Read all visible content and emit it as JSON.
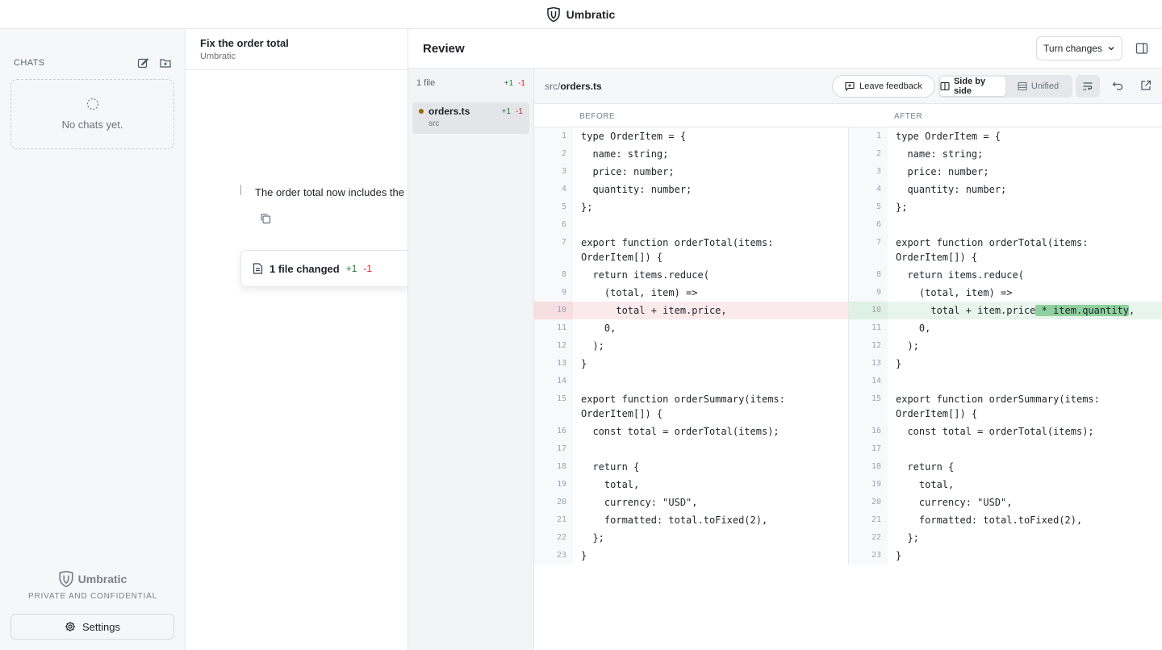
{
  "app": {
    "title": "Umbratic"
  },
  "sidebar": {
    "chats_label": "CHATS",
    "empty_text": "No chats yet.",
    "brand": "Umbratic",
    "tagline": "PRIVATE AND CONFIDENTIAL",
    "settings_label": "Settings"
  },
  "chat": {
    "title": "Fix the order total",
    "subtitle": "Umbratic",
    "message": "The order total now includes the",
    "files_changed": "1 file changed",
    "additions": "+1",
    "deletions": "-1"
  },
  "review": {
    "title": "Review",
    "turn_changes": "Turn changes",
    "file_count": "1 file",
    "additions": "+1",
    "deletions": "-1",
    "file": {
      "name": "orders.ts",
      "dir": "src",
      "additions": "+1",
      "deletions": "-1"
    },
    "path_dir": "src/",
    "path_file": "orders.ts",
    "leave_feedback": "Leave feedback",
    "view_side_by_side": "Side by side",
    "view_unified": "Unified",
    "before_label": "BEFORE",
    "after_label": "AFTER"
  },
  "diff": {
    "before": [
      {
        "n": "1",
        "code": "type OrderItem = {"
      },
      {
        "n": "2",
        "code": "  name: string;"
      },
      {
        "n": "3",
        "code": "  price: number;"
      },
      {
        "n": "4",
        "code": "  quantity: number;"
      },
      {
        "n": "5",
        "code": "};"
      },
      {
        "n": "6",
        "code": ""
      },
      {
        "n": "7",
        "code": "export function orderTotal(items: OrderItem[]) {"
      },
      {
        "n": "8",
        "code": "  return items.reduce("
      },
      {
        "n": "9",
        "code": "    (total, item) =>"
      },
      {
        "n": "10",
        "code": "      total + item.price,",
        "type": "del"
      },
      {
        "n": "11",
        "code": "    0,"
      },
      {
        "n": "12",
        "code": "  );"
      },
      {
        "n": "13",
        "code": "}"
      },
      {
        "n": "14",
        "code": ""
      },
      {
        "n": "15",
        "code": "export function orderSummary(items: OrderItem[]) {"
      },
      {
        "n": "16",
        "code": "  const total = orderTotal(items);"
      },
      {
        "n": "17",
        "code": ""
      },
      {
        "n": "18",
        "code": "  return {"
      },
      {
        "n": "19",
        "code": "    total,"
      },
      {
        "n": "20",
        "code": "    currency: \"USD\","
      },
      {
        "n": "21",
        "code": "    formatted: total.toFixed(2),"
      },
      {
        "n": "22",
        "code": "  };"
      },
      {
        "n": "23",
        "code": "}"
      }
    ],
    "after": [
      {
        "n": "1",
        "code": "type OrderItem = {"
      },
      {
        "n": "2",
        "code": "  name: string;"
      },
      {
        "n": "3",
        "code": "  price: number;"
      },
      {
        "n": "4",
        "code": "  quantity: number;"
      },
      {
        "n": "5",
        "code": "};"
      },
      {
        "n": "6",
        "code": ""
      },
      {
        "n": "7",
        "code": "export function orderTotal(items: OrderItem[]) {"
      },
      {
        "n": "8",
        "code": "  return items.reduce("
      },
      {
        "n": "9",
        "code": "    (total, item) =>"
      },
      {
        "n": "10",
        "code": "      total + item.price",
        "hl": " * item.quantity",
        "tail": ",",
        "type": "add"
      },
      {
        "n": "11",
        "code": "    0,"
      },
      {
        "n": "12",
        "code": "  );"
      },
      {
        "n": "13",
        "code": "}"
      },
      {
        "n": "14",
        "code": ""
      },
      {
        "n": "15",
        "code": "export function orderSummary(items: OrderItem[]) {"
      },
      {
        "n": "16",
        "code": "  const total = orderTotal(items);"
      },
      {
        "n": "17",
        "code": ""
      },
      {
        "n": "18",
        "code": "  return {"
      },
      {
        "n": "19",
        "code": "    total,"
      },
      {
        "n": "20",
        "code": "    currency: \"USD\","
      },
      {
        "n": "21",
        "code": "    formatted: total.toFixed(2),"
      },
      {
        "n": "22",
        "code": "  };"
      },
      {
        "n": "23",
        "code": "}"
      }
    ]
  }
}
